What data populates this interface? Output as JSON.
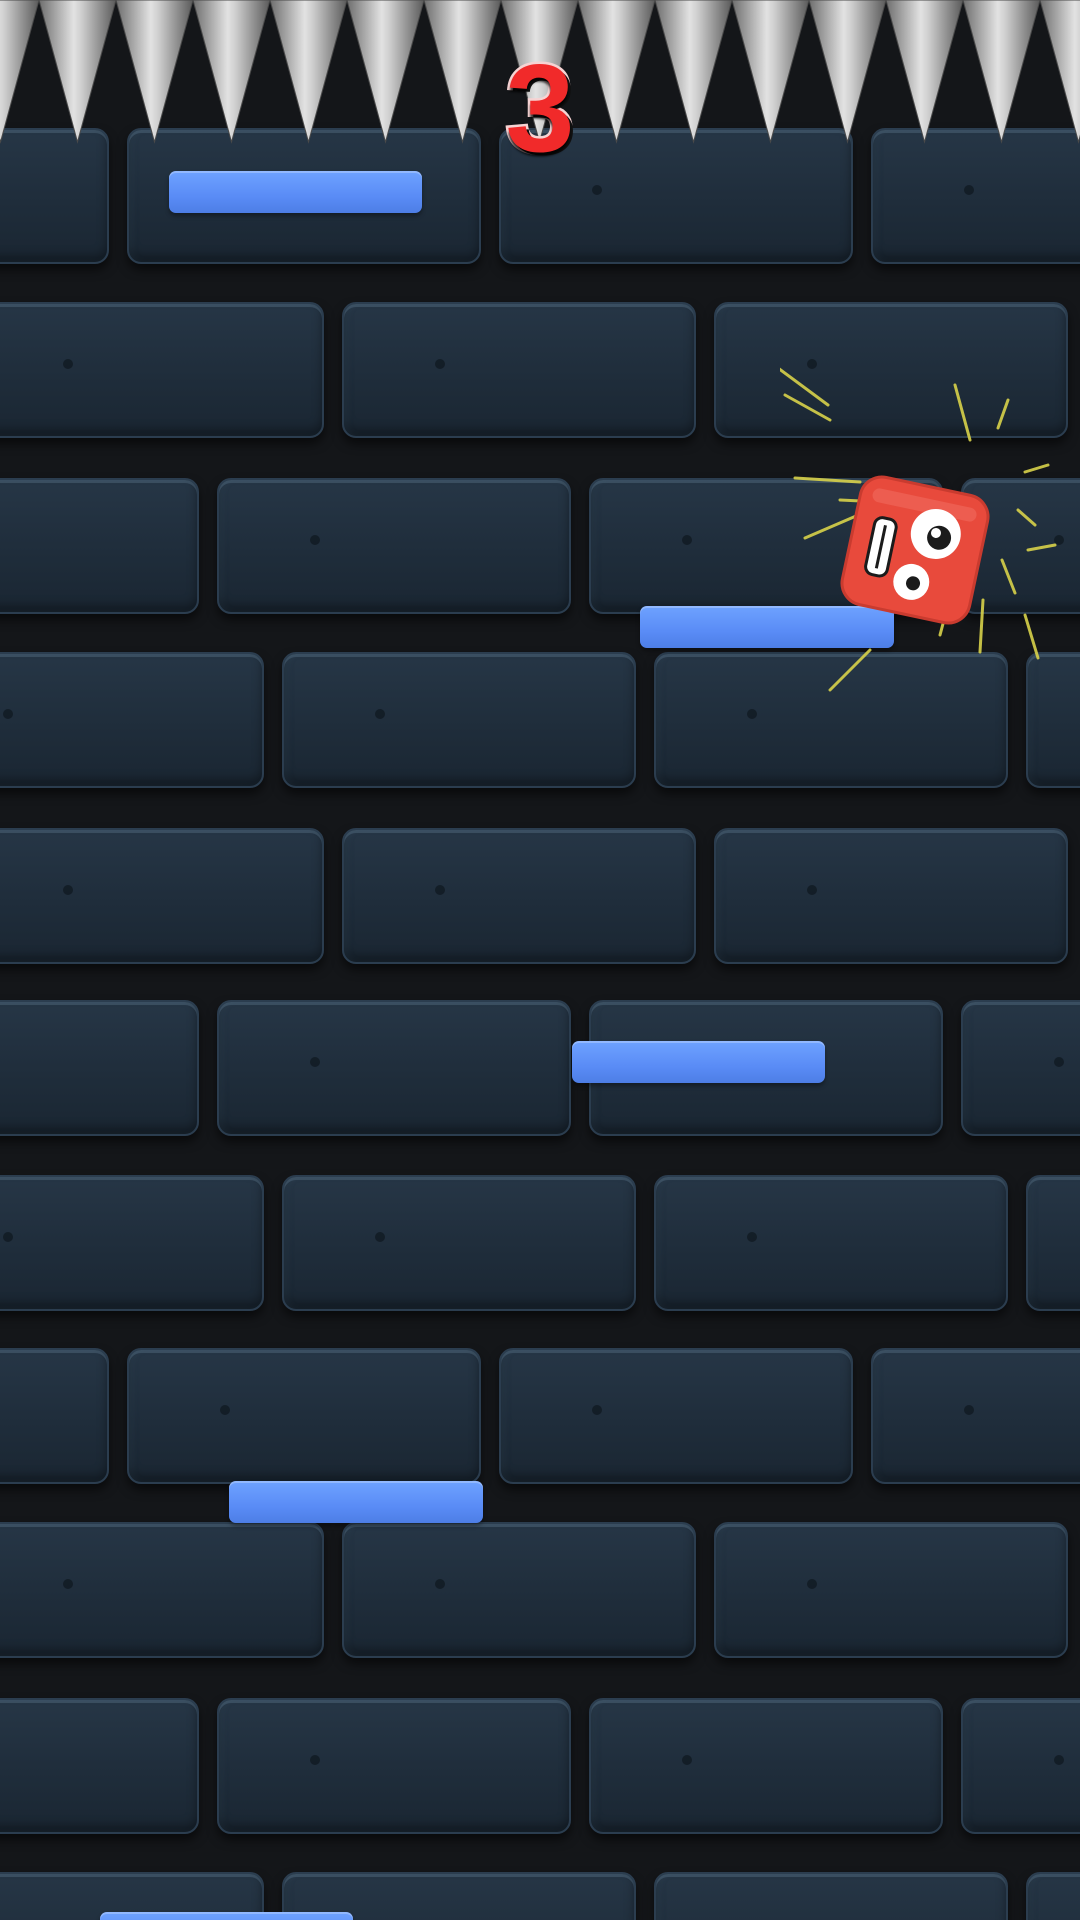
{
  "hud": {
    "score": "3"
  },
  "hazard": {
    "type": "spike-ceiling-icon"
  },
  "player": {
    "character": "red-block-character-icon",
    "color": "#e84a3c"
  },
  "platforms": {
    "color": "#5b8ef7"
  },
  "colors": {
    "wall_brick": "#223242",
    "mortar": "#141619",
    "score_fill": "#f12a2a",
    "score_outline": "#f6d3d3"
  }
}
